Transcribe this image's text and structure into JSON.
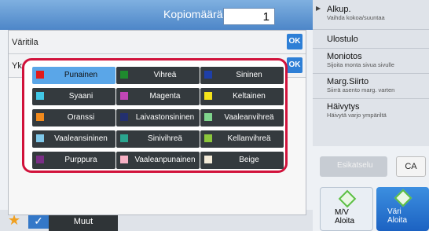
{
  "header": {
    "copies_label": "Kopiomäärä",
    "copies_value": "1"
  },
  "dialog": {
    "color_mode_label": "Väritila",
    "mono_label": "Yksivärinen",
    "ok_label": "OK"
  },
  "colors": [
    {
      "name": "Punainen",
      "swatch": "#e31b1b",
      "selected": true
    },
    {
      "name": "Vihreä",
      "swatch": "#1f8a2e"
    },
    {
      "name": "Sininen",
      "swatch": "#1e3fa8"
    },
    {
      "name": "Syaani",
      "swatch": "#41c7e6"
    },
    {
      "name": "Magenta",
      "swatch": "#c046b6"
    },
    {
      "name": "Keltainen",
      "swatch": "#f5e31a"
    },
    {
      "name": "Oranssi",
      "swatch": "#f28a1c"
    },
    {
      "name": "Laivastonsininen",
      "swatch": "#23306f"
    },
    {
      "name": "Vaaleanvihreä",
      "swatch": "#7fd48c"
    },
    {
      "name": "Vaaleansininen",
      "swatch": "#7fc8ea"
    },
    {
      "name": "Sinivihreä",
      "swatch": "#2aa58f"
    },
    {
      "name": "Kellanvihreä",
      "swatch": "#8cc63c"
    },
    {
      "name": "Purppura",
      "swatch": "#7a2e86"
    },
    {
      "name": "Vaaleanpunainen",
      "swatch": "#f6b0c4"
    },
    {
      "name": "Beige",
      "swatch": "#f2ead8"
    }
  ],
  "side_menu": [
    {
      "title": "Alkup.",
      "sub": "Vaihda kokoa/suuntaa"
    },
    {
      "title": "Ulostulo",
      "sub": ""
    },
    {
      "title": "Moniotos",
      "sub": "Sijoita monta sivua sivulle"
    },
    {
      "title": "Marg.Siirto",
      "sub": "Siirrä asento marg. varten"
    },
    {
      "title": "Häivytys",
      "sub": "Häivytä varjo ympäriltä"
    }
  ],
  "buttons": {
    "faded_label": "Esikatselu",
    "ca_label": "CA",
    "start_bw": "M/V\nAloita",
    "start_color": "Väri\nAloita"
  },
  "bottom": {
    "muut_label": "Muut"
  }
}
